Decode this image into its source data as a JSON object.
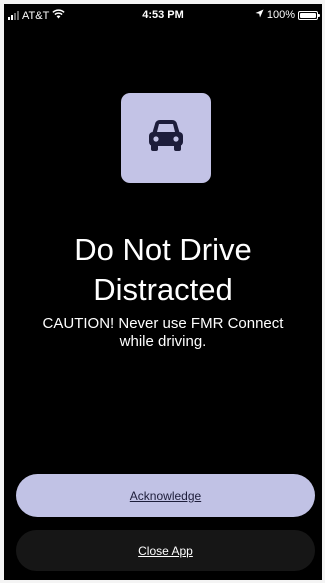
{
  "status_bar": {
    "carrier": "AT&T",
    "time": "4:53 PM",
    "battery": "100%",
    "battery_level": 1.0,
    "icons": [
      "cellular-signal-icon",
      "wifi-icon",
      "location-arrow-icon",
      "battery-icon"
    ]
  },
  "main": {
    "icon": "car-icon",
    "title_line1": "Do Not Drive",
    "title_line2": "Distracted",
    "caution_line1": "CAUTION! Never use FMR Connect",
    "caution_line2": "while driving."
  },
  "actions": {
    "acknowledge_label": "Acknowledge",
    "close_label": "Close App"
  },
  "colors": {
    "background": "#000000",
    "accent": "#c1c2e5",
    "icon_tile": "#c3c3e6",
    "icon_glyph": "#1d1d3a",
    "secondary_button": "#161616",
    "text": "#ffffff"
  }
}
